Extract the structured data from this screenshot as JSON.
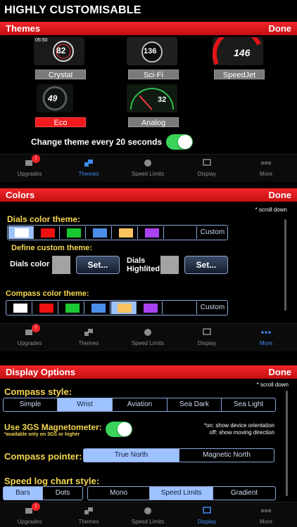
{
  "headline": "HIGHLY CUSTOMISABLE",
  "themes_panel": {
    "title": "Themes",
    "done_label": "Done",
    "themes": [
      {
        "label": "Crystal",
        "readout": "82",
        "selected": false
      },
      {
        "label": "Sci-Fi",
        "readout": "136",
        "selected": false
      },
      {
        "label": "SpeedJet",
        "readout": "146",
        "selected": false
      },
      {
        "label": "Eco",
        "readout": "49",
        "selected": true
      },
      {
        "label": "Analog",
        "readout": "32",
        "selected": false
      }
    ],
    "crystal_time": "05:50",
    "change_label": "Change theme every 20 seconds",
    "change_enabled": true
  },
  "tabbar_1": {
    "items": [
      {
        "label": "Upgrades",
        "badge": "!",
        "icon": "tag-icon"
      },
      {
        "label": "Themes",
        "icon": "themes-icon",
        "active": true
      },
      {
        "label": "Speed Limits",
        "icon": "speedometer-icon"
      },
      {
        "label": "Display",
        "icon": "monitor-icon"
      },
      {
        "label": "More",
        "icon": "more-dots-icon"
      }
    ]
  },
  "colors_panel": {
    "title": "Colors",
    "done_label": "Done",
    "scroll_hint": "* scroll down",
    "dials_label": "Dials color theme:",
    "define_label": "Define custom theme:",
    "dials_color_label": "Dials color",
    "dials_highlighted_label": "Dials\nHighlited",
    "set_label_1": "Set...",
    "set_label_2": "Set...",
    "compass_label": "Compass color theme:",
    "custom_label_1": "Custom",
    "custom_label_2": "Custom",
    "swatch_colors": [
      "#ffffff",
      "#ee1111",
      "#19c832",
      "#4a8eea",
      "#f8c460",
      "#a942f2"
    ],
    "custom_grey": "#a3a3a3"
  },
  "tabbar_2": {
    "items": [
      {
        "label": "Upgrades",
        "badge": "!",
        "icon": "tag-icon"
      },
      {
        "label": "Themes",
        "icon": "themes-icon"
      },
      {
        "label": "Speed Limits",
        "icon": "speedometer-icon"
      },
      {
        "label": "Display",
        "icon": "monitor-icon"
      },
      {
        "label": "More",
        "icon": "more-dots-icon",
        "active": true
      }
    ]
  },
  "display_panel": {
    "title": "Display Options",
    "done_label": "Done",
    "scroll_hint": "* scroll down",
    "compass_style_label": "Compass style:",
    "compass_styles": [
      "Simple",
      "Wrist",
      "Aviation",
      "Sea Dark",
      "Sea Light"
    ],
    "compass_style_selected": "Wrist",
    "magnetometer_label": "Use 3GS Magnetometer:",
    "magnetometer_note": "*available only on 3GS or higher",
    "magnetometer_enabled": true,
    "magnetometer_hint_1": "*on: show device orientation",
    "magnetometer_hint_2": "off: show moving direction",
    "pointer_label": "Compass pointer:",
    "pointer_options": [
      "True North",
      "Magnetic North"
    ],
    "pointer_selected": "True North",
    "speedlog_label": "Speed log chart style:",
    "speedlog_a": [
      "Bars",
      "Dots"
    ],
    "speedlog_a_selected": "Bars",
    "speedlog_b": [
      "Mono",
      "Speed Limits",
      "Gradient"
    ],
    "speedlog_b_selected": "Speed Limits"
  },
  "tabbar_3": {
    "items": [
      {
        "label": "Upgrades",
        "badge": "!",
        "icon": "tag-icon"
      },
      {
        "label": "Themes",
        "icon": "themes-icon"
      },
      {
        "label": "Speed Limits",
        "icon": "speedometer-icon"
      },
      {
        "label": "Display",
        "icon": "monitor-icon",
        "active": true
      },
      {
        "label": "More",
        "icon": "more-dots-icon"
      }
    ]
  },
  "colors": {
    "red_bar": "#e11418",
    "active_tab": "#3e8df0",
    "label_yellow": "#f6d84e",
    "toggle_on": "#3bd35a",
    "segment_selected": "#9ec2ff"
  }
}
